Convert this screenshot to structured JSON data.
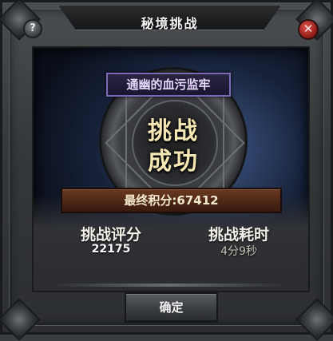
{
  "dialog": {
    "title": "秘境挑战",
    "help_symbol": "?",
    "close_symbol": "✕"
  },
  "dungeon": {
    "name": "通幽的血污监牢"
  },
  "result": {
    "line1": "挑战",
    "line2": "成功"
  },
  "score": {
    "text": "最终积分:67412"
  },
  "stats": {
    "rating_label": "挑战评分",
    "rating_value": "22175",
    "time_label": "挑战耗时",
    "time_value": "4分9秒"
  },
  "buttons": {
    "confirm_label": "确定"
  }
}
